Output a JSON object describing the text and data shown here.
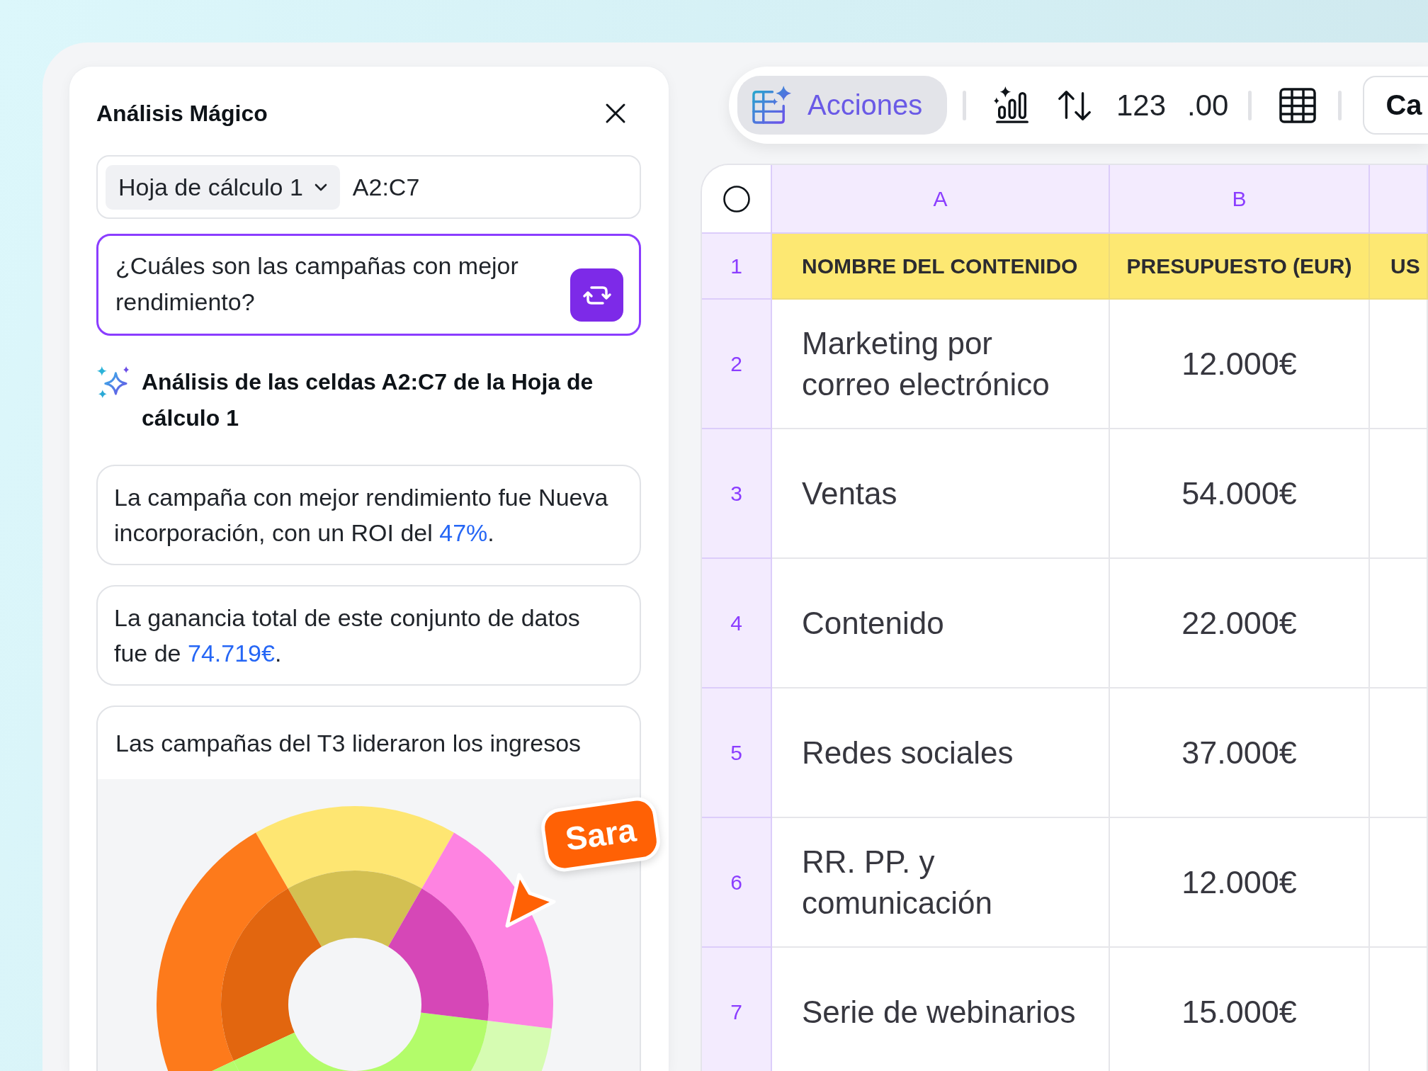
{
  "panel": {
    "title": "Análisis Mágico"
  },
  "source": {
    "sheet": "Hoja de cálculo 1",
    "range": "A2:C7"
  },
  "prompt": {
    "value": "¿Cuáles son las campañas con mejor rendimiento?"
  },
  "analysis_heading": "Análisis de las celdas A2:C7 de la Hoja de cálculo 1",
  "insights": [
    {
      "kind": "text",
      "parts": [
        {
          "text": "La campaña con mejor rendimiento fue Nueva incorporación, con un ROI del ",
          "highlight": false
        },
        {
          "text": "47%",
          "highlight": true
        },
        {
          "text": ".",
          "highlight": false
        }
      ]
    },
    {
      "kind": "text",
      "parts": [
        {
          "text": "La ganancia total de este conjunto de datos fue de ",
          "highlight": false
        },
        {
          "text": "74.719€",
          "highlight": true
        },
        {
          "text": ".",
          "highlight": false
        }
      ]
    },
    {
      "kind": "chart",
      "title": "Las campañas del T3 lideraron los ingresos"
    }
  ],
  "collaborator_cursor": {
    "name": "Sara"
  },
  "toolbar": {
    "groups": [
      [
        {
          "kind": "magic",
          "label": "Acciones",
          "selected": true
        }
      ],
      [
        {
          "kind": "chart",
          "selected": false
        },
        {
          "kind": "sort",
          "selected": false
        },
        {
          "kind": "text",
          "label": "123",
          "selected": false
        },
        {
          "kind": "text",
          "label": ".00",
          "selected": false
        }
      ],
      [
        {
          "kind": "table",
          "selected": false
        }
      ],
      [
        {
          "kind": "outlined",
          "label": "Ca",
          "selected": false
        }
      ]
    ]
  },
  "sheet": {
    "columns": [
      "A",
      "B"
    ],
    "rows": [
      {
        "number": "1",
        "kind": "header",
        "cells": [
          "NOMBRE DEL CONTENIDO",
          "PRESUPUESTO (EUR)",
          "US"
        ]
      },
      {
        "number": "2",
        "kind": "data",
        "cells": [
          "Marketing por correo electrónico",
          "12.000€"
        ]
      },
      {
        "number": "3",
        "kind": "data",
        "cells": [
          "Ventas",
          "54.000€"
        ]
      },
      {
        "number": "4",
        "kind": "data",
        "cells": [
          "Contenido",
          "22.000€"
        ]
      },
      {
        "number": "5",
        "kind": "data",
        "cells": [
          "Redes sociales",
          "37.000€"
        ]
      },
      {
        "number": "6",
        "kind": "data",
        "cells": [
          "RR. PP. y comunicación",
          "12.000€"
        ]
      },
      {
        "number": "7",
        "kind": "data",
        "cells": [
          "Serie de webinarios",
          "15.000€"
        ]
      }
    ]
  }
}
